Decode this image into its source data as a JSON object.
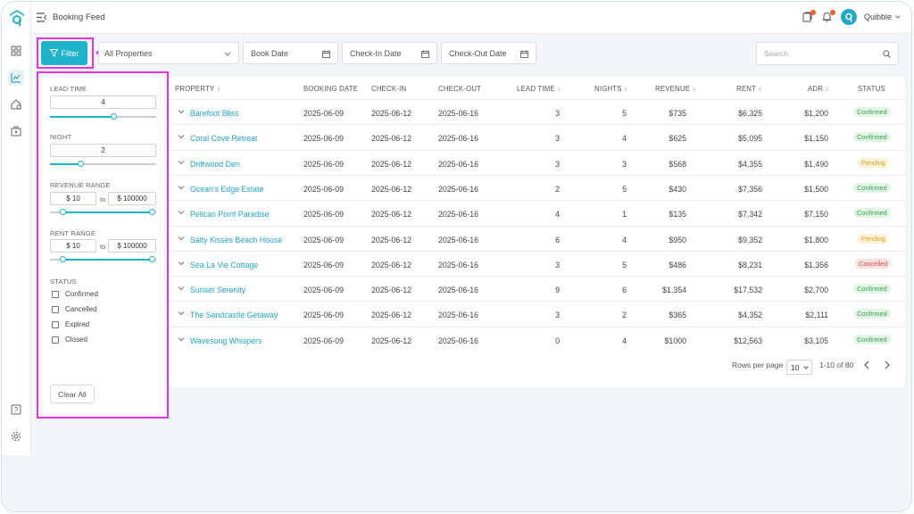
{
  "header": {
    "page_title": "Booking Feed",
    "user_name": "Quibble"
  },
  "toolbar": {
    "filter_label": "Filter",
    "property_select": "All Properties",
    "book_date": "Book Date",
    "check_in_date": "Check-In Date",
    "check_out_date": "Check-Out Date",
    "search_placeholder": "Search"
  },
  "filter_panel": {
    "lead_time_label": "LEAD TIME",
    "lead_time_value": "4",
    "lead_time_slider_fraction": 0.6,
    "night_label": "NIGHT",
    "night_value": "2",
    "night_slider_fraction": 0.29,
    "revenue_label": "REVENUE RANGE",
    "revenue_min": "$ 10",
    "revenue_max": "$ 100000",
    "rent_label": "RENT RANGE",
    "rent_min": "$ 10",
    "rent_max": "$ 100000",
    "to_label": "to",
    "status_label": "STATUS",
    "status_options": [
      "Confirmed",
      "Cancelled",
      "Expired",
      "Closed"
    ],
    "clear_label": "Clear All"
  },
  "table": {
    "columns": [
      "PROPERTY",
      "BOOKING DATE",
      "CHECK-IN",
      "CHECK-OUT",
      "LEAD TIME",
      "NIGHTS",
      "REVENUE",
      "RENT",
      "ADR",
      "STATUS"
    ],
    "rows": [
      {
        "property": "Barefoot Bliss",
        "booking_date": "2025-06-09",
        "check_in": "2025-06-12",
        "check_out": "2025-06-16",
        "lead_time": "3",
        "nights": "5",
        "revenue": "$735",
        "rent": "$6,325",
        "adr": "$1,200",
        "status": "Confirmed"
      },
      {
        "property": "Coral Cove Retreat",
        "booking_date": "2025-06-09",
        "check_in": "2025-06-12",
        "check_out": "2025-06-16",
        "lead_time": "3",
        "nights": "4",
        "revenue": "$625",
        "rent": "$5,095",
        "adr": "$1,150",
        "status": "Confirmed"
      },
      {
        "property": "Driftwood Den",
        "booking_date": "2025-06-09",
        "check_in": "2025-06-12",
        "check_out": "2025-06-16",
        "lead_time": "3",
        "nights": "3",
        "revenue": "$568",
        "rent": "$4,355",
        "adr": "$1,490",
        "status": "Pending"
      },
      {
        "property": "Ocean's Edge Estate",
        "booking_date": "2025-06-09",
        "check_in": "2025-06-12",
        "check_out": "2025-06-16",
        "lead_time": "2",
        "nights": "5",
        "revenue": "$430",
        "rent": "$7,356",
        "adr": "$1,500",
        "status": "Confirmed"
      },
      {
        "property": "Pelican Point Paradise",
        "booking_date": "2025-06-09",
        "check_in": "2025-06-12",
        "check_out": "2025-06-16",
        "lead_time": "4",
        "nights": "1",
        "revenue": "$135",
        "rent": "$7,342",
        "adr": "$7,150",
        "status": "Confirmed"
      },
      {
        "property": "Salty Kisses Beach House",
        "booking_date": "2025-06-09",
        "check_in": "2025-06-12",
        "check_out": "2025-06-16",
        "lead_time": "6",
        "nights": "4",
        "revenue": "$950",
        "rent": "$9,352",
        "adr": "$1,800",
        "status": "Pending"
      },
      {
        "property": "Sea La Vie Cottage",
        "booking_date": "2025-06-09",
        "check_in": "2025-06-12",
        "check_out": "2025-06-16",
        "lead_time": "3",
        "nights": "5",
        "revenue": "$486",
        "rent": "$8,231",
        "adr": "$1,356",
        "status": "Cancelled"
      },
      {
        "property": "Sunset Serenity",
        "booking_date": "2025-06-09",
        "check_in": "2025-06-12",
        "check_out": "2025-06-16",
        "lead_time": "9",
        "nights": "6",
        "revenue": "$1,354",
        "rent": "$17,532",
        "adr": "$2,700",
        "status": "Confirmed"
      },
      {
        "property": "The Sandcastle Getaway",
        "booking_date": "2025-06-09",
        "check_in": "2025-06-12",
        "check_out": "2025-06-16",
        "lead_time": "3",
        "nights": "2",
        "revenue": "$365",
        "rent": "$4,352",
        "adr": "$2,111",
        "status": "Confirmed"
      },
      {
        "property": "Wavesong Whispers",
        "booking_date": "2025-06-09",
        "check_in": "2025-06-12",
        "check_out": "2025-06-16",
        "lead_time": "0",
        "nights": "4",
        "revenue": "$1000",
        "rent": "$12,563",
        "adr": "$3,105",
        "status": "Confirmed"
      }
    ]
  },
  "pagination": {
    "rows_per_page_label": "Rows per page",
    "rows_per_page": "10",
    "range": "1-10 of 80"
  },
  "colors": {
    "accent": "#1fb3cc",
    "highlight": "#e633e6",
    "confirmed_bg": "#e3f6e6",
    "confirmed_fg": "#3aa14f",
    "pending_bg": "#fdf2d6",
    "pending_fg": "#d8a629",
    "cancelled_bg": "#fbe1e1",
    "cancelled_fg": "#d9534f"
  }
}
